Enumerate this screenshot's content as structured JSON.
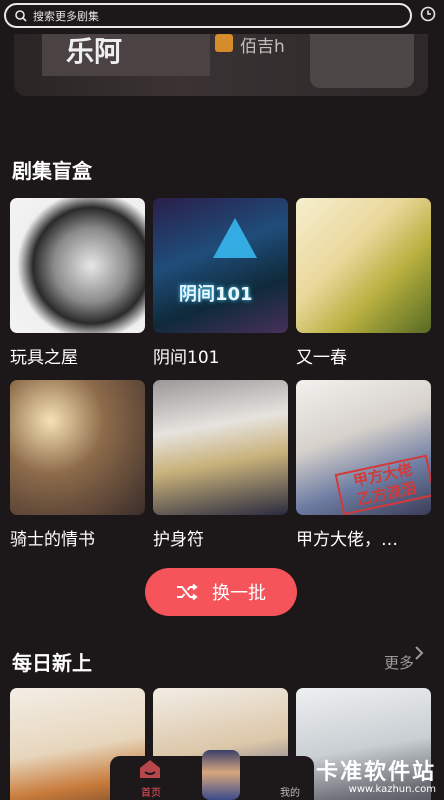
{
  "search": {
    "placeholder": "搜索更多剧集"
  },
  "banner": {
    "left_text": "乐阿",
    "right_text": "佰吉h"
  },
  "blind_box": {
    "title": "剧集盲盒",
    "items": [
      {
        "title": "玩具之屋"
      },
      {
        "title": "阴间101",
        "cover_text": "阴间101"
      },
      {
        "title": "又一春"
      },
      {
        "title": "骑士的情书"
      },
      {
        "title": "护身符"
      },
      {
        "title": "甲方大佬，…",
        "stamp_text": "甲方大佬\n乙方流泪"
      }
    ],
    "shuffle_label": "换一批"
  },
  "daily_new": {
    "title": "每日新上",
    "more_label": "更多"
  },
  "bottom_nav": {
    "home_label": "首页",
    "mine_label": "我的"
  },
  "watermark": {
    "main": "卡准软件站",
    "sub": "www.kazhun.com"
  },
  "colors": {
    "accent": "#f4545a",
    "background": "#1c1718"
  }
}
